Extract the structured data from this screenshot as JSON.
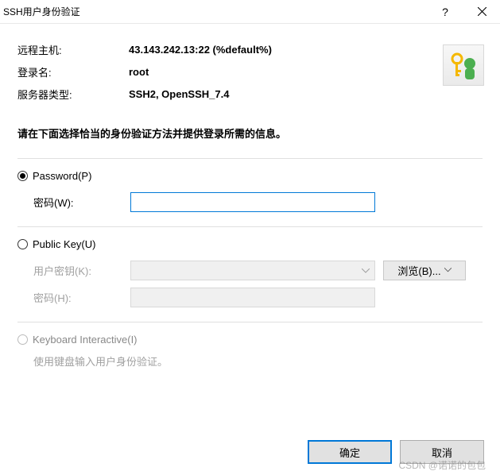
{
  "titlebar": {
    "title": "SSH用户身份验证",
    "help": "?",
    "close": "×"
  },
  "info": {
    "remoteHostLabel": "远程主机:",
    "remoteHostValue": "43.143.242.13:22 (%default%)",
    "loginLabel": "登录名:",
    "loginValue": "root",
    "serverTypeLabel": "服务器类型:",
    "serverTypeValue": "SSH2, OpenSSH_7.4"
  },
  "instruction": "请在下面选择恰当的身份验证方法并提供登录所需的信息。",
  "auth": {
    "password": {
      "radioLabel": "Password(P)",
      "passwordLabel": "密码(W):",
      "passwordValue": ""
    },
    "publicKey": {
      "radioLabel": "Public Key(U)",
      "userKeyLabel": "用户密钥(K):",
      "userKeyValue": "",
      "browseLabel": "浏览(B)...",
      "passwordLabel": "密码(H):",
      "passwordValue": ""
    },
    "keyboard": {
      "radioLabel": "Keyboard Interactive(I)",
      "hint": "使用键盘输入用户身份验证。"
    }
  },
  "buttons": {
    "ok": "确定",
    "cancel": "取消"
  },
  "watermark": "CSDN @诺诺的包包"
}
